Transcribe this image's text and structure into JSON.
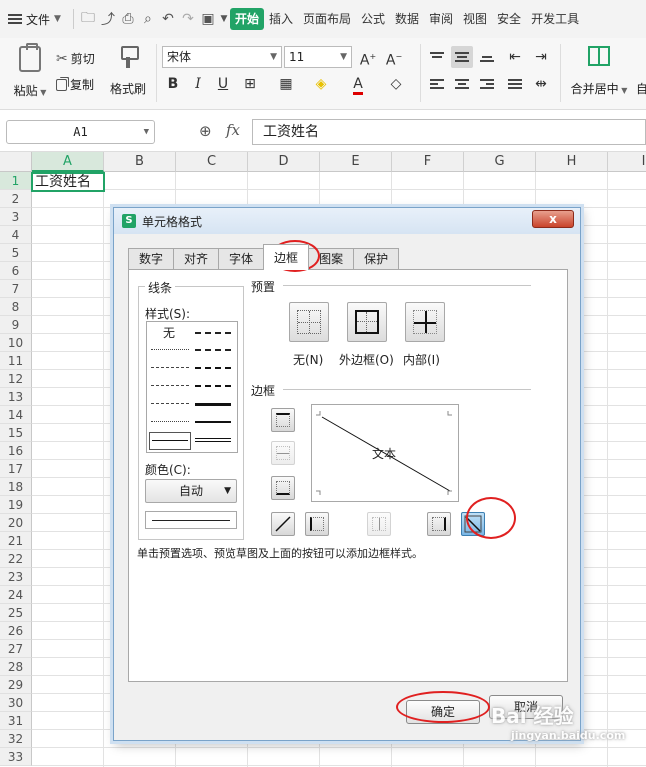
{
  "menubar": {
    "file_label": "文件",
    "tabs": [
      {
        "label": "开始",
        "active": true
      },
      {
        "label": "插入",
        "active": false
      },
      {
        "label": "页面布局",
        "active": false
      },
      {
        "label": "公式",
        "active": false
      },
      {
        "label": "数据",
        "active": false
      },
      {
        "label": "审阅",
        "active": false
      },
      {
        "label": "视图",
        "active": false
      },
      {
        "label": "安全",
        "active": false
      },
      {
        "label": "开发工具",
        "active": false
      }
    ]
  },
  "ribbon": {
    "paste": "粘贴",
    "cut": "剪切",
    "copy": "复制",
    "format_painter": "格式刷",
    "font_name": "宋体",
    "font_size": "11",
    "merge_center": "合并居中",
    "auto_label": "自"
  },
  "formula_bar": {
    "name_box": "A1",
    "fx": "fx",
    "content": "工资姓名"
  },
  "sheet": {
    "columns": [
      "A",
      "B",
      "C",
      "D",
      "E",
      "F",
      "G",
      "H",
      "I"
    ],
    "rows": [
      "1",
      "2",
      "3",
      "4",
      "5",
      "6",
      "7",
      "8",
      "9",
      "10",
      "11",
      "12",
      "13",
      "14",
      "15",
      "16",
      "17",
      "18",
      "19",
      "20",
      "21",
      "22",
      "23",
      "24",
      "25",
      "26",
      "27",
      "28",
      "29",
      "30",
      "31",
      "32",
      "33"
    ],
    "cell_a1": "工资姓名",
    "accent": "#21a366"
  },
  "dialog": {
    "title": "单元格格式",
    "close": "x",
    "tabs": [
      "数字",
      "对齐",
      "字体",
      "边框",
      "图案",
      "保护"
    ],
    "active_tab": "边框",
    "line_group": "线条",
    "style_label": "样式(S):",
    "style_none": "无",
    "color_label": "颜色(C):",
    "color_value": "自动",
    "preset_group": "预置",
    "presets": [
      "无(N)",
      "外边框(O)",
      "内部(I)"
    ],
    "border_group": "边框",
    "preview_text": "文本",
    "hint": "单击预置选项、预览草图及上面的按钮可以添加边框样式。",
    "ok": "确定",
    "cancel": "取消"
  },
  "watermark": {
    "text": "Bai 经验",
    "sub": "jingyan.baidu.com"
  }
}
